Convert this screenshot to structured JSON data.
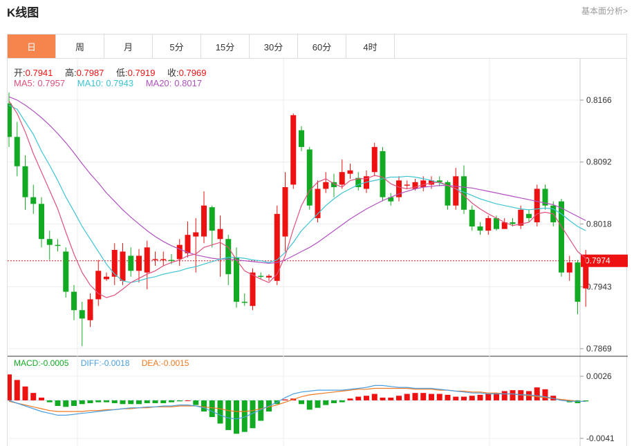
{
  "header": {
    "title": "K线图",
    "link": "基本面分析>"
  },
  "tabs": [
    {
      "label": "日",
      "active": true
    },
    {
      "label": "周",
      "active": false
    },
    {
      "label": "月",
      "active": false
    },
    {
      "label": "5分",
      "active": false
    },
    {
      "label": "15分",
      "active": false
    },
    {
      "label": "30分",
      "active": false
    },
    {
      "label": "60分",
      "active": false
    },
    {
      "label": "4时",
      "active": false
    }
  ],
  "ohlc_info": {
    "open_label": "开:",
    "open": "0.7941",
    "high_label": "高:",
    "high": "0.7987",
    "low_label": "低:",
    "low": "0.7919",
    "close_label": "收:",
    "close": "0.7969"
  },
  "ma_info": {
    "ma5_label": "MA5:",
    "ma5": "0.7957",
    "ma10_label": "MA10:",
    "ma10": "0.7943",
    "ma20_label": "MA20:",
    "ma20": "0.8017"
  },
  "macd_info": {
    "macd_label": "MACD:",
    "macd": "-0.0005",
    "diff_label": "DIFF:",
    "diff": "-0.0018",
    "dea_label": "DEA:",
    "dea": "-0.0015"
  },
  "colors": {
    "up": "#ee1111",
    "down": "#11aa22",
    "ma5": "#e0507a",
    "ma10": "#3cc4d4",
    "ma20": "#b050c0",
    "diff": "#4a9ee0",
    "dea": "#f07820",
    "accent": "#f5854d",
    "current_price": "#ee1111"
  },
  "chart_data": [
    {
      "type": "candlestick",
      "price_ticks": [
        "0.8166",
        "0.8092",
        "0.8018",
        "0.7943",
        "0.7869"
      ],
      "ylim": [
        0.7869,
        0.8166
      ],
      "current_price": "0.7974",
      "candles": [
        [
          0.8162,
          0.8122,
          0.8175,
          0.811
        ],
        [
          0.8122,
          0.8087,
          0.814,
          0.8075
        ],
        [
          0.8087,
          0.805,
          0.81,
          0.8035
        ],
        [
          0.805,
          0.8042,
          0.8065,
          0.803
        ],
        [
          0.8042,
          0.8,
          0.805,
          0.799
        ],
        [
          0.8,
          0.7993,
          0.801,
          0.7975
        ],
        [
          0.7993,
          0.7992,
          0.8,
          0.7985
        ],
        [
          0.7985,
          0.7937,
          0.799,
          0.793
        ],
        [
          0.7937,
          0.7915,
          0.7945,
          0.7903
        ],
        [
          0.7915,
          0.7905,
          0.7925,
          0.7872
        ],
        [
          0.7903,
          0.7928,
          0.7935,
          0.7895
        ],
        [
          0.7928,
          0.7962,
          0.7975,
          0.792
        ],
        [
          0.7952,
          0.7955,
          0.796,
          0.795
        ],
        [
          0.7955,
          0.7987,
          0.7995,
          0.7945
        ],
        [
          0.795,
          0.7985,
          0.7995,
          0.7945
        ],
        [
          0.798,
          0.7962,
          0.799,
          0.7955
        ],
        [
          0.7962,
          0.798,
          0.7988,
          0.7948
        ],
        [
          0.796,
          0.799,
          0.7998,
          0.794
        ],
        [
          0.7975,
          0.7976,
          0.7985,
          0.7968
        ],
        [
          0.7975,
          0.7976,
          0.7985,
          0.7968
        ],
        [
          0.7975,
          0.7974,
          0.7982,
          0.797
        ],
        [
          0.7976,
          0.7993,
          0.8,
          0.7968
        ],
        [
          0.7983,
          0.8005,
          0.8021,
          0.7978
        ],
        [
          0.8003,
          0.8008,
          0.8025,
          0.796
        ],
        [
          0.8003,
          0.804,
          0.8057,
          0.7995
        ],
        [
          0.8038,
          0.801,
          0.804,
          0.799
        ],
        [
          0.8,
          0.8012,
          0.8028,
          0.7955
        ],
        [
          0.8,
          0.7958,
          0.8005,
          0.7945
        ],
        [
          0.7978,
          0.7925,
          0.799,
          0.7918
        ],
        [
          0.7925,
          0.7924,
          0.7935,
          0.792
        ],
        [
          0.792,
          0.796,
          0.7965,
          0.7915
        ],
        [
          0.7956,
          0.7955,
          0.796,
          0.7952
        ],
        [
          0.7954,
          0.7956,
          0.7958,
          0.795
        ],
        [
          0.795,
          0.803,
          0.804,
          0.7945
        ],
        [
          0.8003,
          0.8062,
          0.808,
          0.7985
        ],
        [
          0.8065,
          0.8148,
          0.815,
          0.806
        ],
        [
          0.813,
          0.811,
          0.8135,
          0.8105
        ],
        [
          0.8107,
          0.804,
          0.811,
          0.8035
        ],
        [
          0.8025,
          0.806,
          0.807,
          0.802
        ],
        [
          0.806,
          0.8068,
          0.808,
          0.8055
        ],
        [
          0.8068,
          0.8062,
          0.8078,
          0.805
        ],
        [
          0.8065,
          0.808,
          0.8095,
          0.806
        ],
        [
          0.8078,
          0.8082,
          0.809,
          0.8072
        ],
        [
          0.8073,
          0.8062,
          0.808,
          0.8058
        ],
        [
          0.806,
          0.8075,
          0.8082,
          0.8055
        ],
        [
          0.808,
          0.811,
          0.8115,
          0.8075
        ],
        [
          0.8105,
          0.805,
          0.811,
          0.8045
        ],
        [
          0.805,
          0.8045,
          0.8055,
          0.804
        ],
        [
          0.805,
          0.807,
          0.8075,
          0.8045
        ],
        [
          0.8065,
          0.8065,
          0.807,
          0.806
        ],
        [
          0.806,
          0.8068,
          0.8072,
          0.8058
        ],
        [
          0.8062,
          0.807,
          0.8075,
          0.8057
        ],
        [
          0.8065,
          0.807,
          0.8075,
          0.806
        ],
        [
          0.807,
          0.8068,
          0.8075,
          0.8063
        ],
        [
          0.8068,
          0.804,
          0.807,
          0.8035
        ],
        [
          0.804,
          0.8075,
          0.8085,
          0.8035
        ],
        [
          0.8075,
          0.8035,
          0.8088,
          0.803
        ],
        [
          0.8035,
          0.8015,
          0.804,
          0.801
        ],
        [
          0.8015,
          0.801,
          0.802,
          0.8005
        ],
        [
          0.801,
          0.8025,
          0.8028,
          0.8005
        ],
        [
          0.8025,
          0.8012,
          0.8028,
          0.801
        ],
        [
          0.8012,
          0.802,
          0.8025,
          0.8015
        ],
        [
          0.802,
          0.8018,
          0.8025,
          0.8015
        ],
        [
          0.8016,
          0.8035,
          0.804,
          0.8012
        ],
        [
          0.803,
          0.8025,
          0.8035,
          0.802
        ],
        [
          0.802,
          0.806,
          0.8065,
          0.8015
        ],
        [
          0.806,
          0.804,
          0.8065,
          0.8035
        ],
        [
          0.804,
          0.802,
          0.8045,
          0.8015
        ],
        [
          0.8045,
          0.796,
          0.8048,
          0.7955
        ],
        [
          0.796,
          0.7972,
          0.798,
          0.795
        ],
        [
          0.7972,
          0.7925,
          0.7975,
          0.791
        ],
        [
          0.7941,
          0.7969,
          0.7987,
          0.7919
        ]
      ],
      "ma5": [
        0.8165,
        0.815,
        0.8128,
        0.8102,
        0.808,
        0.8058,
        0.8036,
        0.8008,
        0.7982,
        0.796,
        0.7945,
        0.7935,
        0.793,
        0.7933,
        0.794,
        0.7948,
        0.7953,
        0.7958,
        0.7962,
        0.7968,
        0.7972,
        0.7975,
        0.798,
        0.7982,
        0.799,
        0.7993,
        0.7996,
        0.799,
        0.7975,
        0.7962,
        0.7957,
        0.7952,
        0.7948,
        0.7958,
        0.798,
        0.8012,
        0.804,
        0.8058,
        0.8068,
        0.8072,
        0.8066,
        0.8062,
        0.807,
        0.8072,
        0.8072,
        0.8076,
        0.8074,
        0.8066,
        0.8062,
        0.806,
        0.8062,
        0.8065,
        0.8067,
        0.8068,
        0.8064,
        0.806,
        0.8052,
        0.8043,
        0.8036,
        0.803,
        0.8025,
        0.802,
        0.8016,
        0.8018,
        0.802,
        0.803,
        0.8032,
        0.803,
        0.8015,
        0.8,
        0.7985,
        0.7977
      ],
      "ma10": [
        0.816,
        0.8155,
        0.814,
        0.8125,
        0.8105,
        0.8088,
        0.807,
        0.805,
        0.8033,
        0.8015,
        0.8,
        0.7985,
        0.797,
        0.7958,
        0.795,
        0.7948,
        0.795,
        0.7953,
        0.7955,
        0.7958,
        0.796,
        0.7962,
        0.7965,
        0.7967,
        0.797,
        0.7973,
        0.7976,
        0.7978,
        0.7978,
        0.7977,
        0.7975,
        0.7974,
        0.7972,
        0.7975,
        0.7984,
        0.7996,
        0.801,
        0.802,
        0.803,
        0.804,
        0.8048,
        0.8055,
        0.806,
        0.8065,
        0.8068,
        0.807,
        0.8072,
        0.8074,
        0.8074,
        0.8075,
        0.8074,
        0.8072,
        0.807,
        0.8067,
        0.8064,
        0.806,
        0.8056,
        0.8052,
        0.8048,
        0.8045,
        0.8042,
        0.804,
        0.8038,
        0.8036,
        0.8035,
        0.8036,
        0.8037,
        0.8036,
        0.803,
        0.8022,
        0.8015,
        0.801
      ],
      "ma20": [
        0.817,
        0.8166,
        0.816,
        0.8153,
        0.8145,
        0.8136,
        0.8126,
        0.8115,
        0.8103,
        0.809,
        0.8078,
        0.8067,
        0.8055,
        0.8045,
        0.8035,
        0.8026,
        0.8018,
        0.801,
        0.8003,
        0.7997,
        0.7992,
        0.7988,
        0.7984,
        0.7981,
        0.7979,
        0.7977,
        0.7976,
        0.7976,
        0.7975,
        0.7974,
        0.7973,
        0.7972,
        0.7971,
        0.7972,
        0.7975,
        0.798,
        0.7985,
        0.799,
        0.7996,
        0.8003,
        0.801,
        0.8017,
        0.8024,
        0.803,
        0.8036,
        0.8041,
        0.8046,
        0.805,
        0.8054,
        0.8057,
        0.806,
        0.8062,
        0.8063,
        0.8064,
        0.8064,
        0.8063,
        0.8062,
        0.8061,
        0.8059,
        0.8057,
        0.8055,
        0.8053,
        0.8051,
        0.8049,
        0.8047,
        0.8045,
        0.8043,
        0.8041,
        0.8037,
        0.8032,
        0.8027,
        0.8022
      ],
      "macd_ticks": [
        "0.0026",
        "-0.0041"
      ],
      "macd_ylim": [
        -0.0041,
        0.0026
      ],
      "macd": [
        0.0028,
        0.0022,
        0.0015,
        0.0008,
        0.0003,
        -0.0002,
        -0.0006,
        -0.0007,
        -0.0006,
        -0.0004,
        -0.0003,
        -0.0002,
        -0.0002,
        -0.0003,
        -0.0004,
        -0.0004,
        -0.0004,
        -0.0003,
        -0.0003,
        -0.0003,
        -0.0002,
        -0.0001,
        0.0,
        -0.0005,
        -0.0012,
        -0.0018,
        -0.0025,
        -0.0032,
        -0.0036,
        -0.0034,
        -0.003,
        -0.0022,
        -0.0012,
        -0.0004,
        0.0001,
        0.0002,
        -0.0004,
        -0.001,
        -0.0008,
        -0.0005,
        -0.0003,
        -0.0002,
        0.0002,
        0.0004,
        0.0005,
        0.0007,
        0.0003,
        0.0003,
        0.0005,
        0.0007,
        0.0008,
        0.0008,
        0.0007,
        0.0007,
        0.0006,
        0.0004,
        0.0004,
        0.0005,
        0.0006,
        0.0007,
        0.0008,
        0.001,
        0.0011,
        0.0011,
        0.001,
        0.0014,
        0.0012,
        0.0005,
        0.0001,
        -0.0002,
        -0.0003,
        -0.0001
      ],
      "diff": [
        0.0,
        -0.0003,
        -0.0006,
        -0.0009,
        -0.0012,
        -0.0014,
        -0.0016,
        -0.0016,
        -0.0015,
        -0.0014,
        -0.0013,
        -0.0012,
        -0.0011,
        -0.001,
        -0.0009,
        -0.0008,
        -0.0008,
        -0.0007,
        -0.0007,
        -0.0006,
        -0.0006,
        -0.0005,
        -0.0005,
        -0.0006,
        -0.0008,
        -0.0012,
        -0.0016,
        -0.0019,
        -0.002,
        -0.0018,
        -0.0014,
        -0.001,
        -0.0006,
        -0.0002,
        0.0003,
        0.0007,
        0.0009,
        0.001,
        0.0011,
        0.0011,
        0.0011,
        0.0011,
        0.0012,
        0.0013,
        0.0014,
        0.0016,
        0.0016,
        0.0015,
        0.0014,
        0.0014,
        0.0013,
        0.0013,
        0.0013,
        0.0012,
        0.0011,
        0.001,
        0.0009,
        0.0008,
        0.0008,
        0.0007,
        0.0007,
        0.0007,
        0.0007,
        0.0006,
        0.0006,
        0.0005,
        0.0004,
        0.0002,
        0.0,
        -0.0001,
        -0.0001,
        -0.0001
      ],
      "dea": [
        -0.0001,
        -0.0003,
        -0.0005,
        -0.0007,
        -0.0009,
        -0.0011,
        -0.0012,
        -0.0012,
        -0.0012,
        -0.0012,
        -0.0011,
        -0.0011,
        -0.001,
        -0.001,
        -0.0009,
        -0.0009,
        -0.0008,
        -0.0008,
        -0.0007,
        -0.0007,
        -0.0007,
        -0.0006,
        -0.0006,
        -0.0006,
        -0.0007,
        -0.0008,
        -0.0009,
        -0.0011,
        -0.0012,
        -0.0012,
        -0.0011,
        -0.0009,
        -0.0007,
        -0.0005,
        -0.0002,
        0.0001,
        0.0004,
        0.0006,
        0.0007,
        0.0008,
        0.0009,
        0.001,
        0.0011,
        0.0012,
        0.0012,
        0.0013,
        0.0013,
        0.0013,
        0.0013,
        0.0013,
        0.0012,
        0.0012,
        0.0012,
        0.0011,
        0.0011,
        0.001,
        0.001,
        0.0009,
        0.0009,
        0.0008,
        0.0008,
        0.0007,
        0.0007,
        0.0006,
        0.0005,
        0.0004,
        0.0003,
        0.0002,
        0.0001,
        0.0,
        -0.0001,
        -0.0001
      ]
    }
  ]
}
